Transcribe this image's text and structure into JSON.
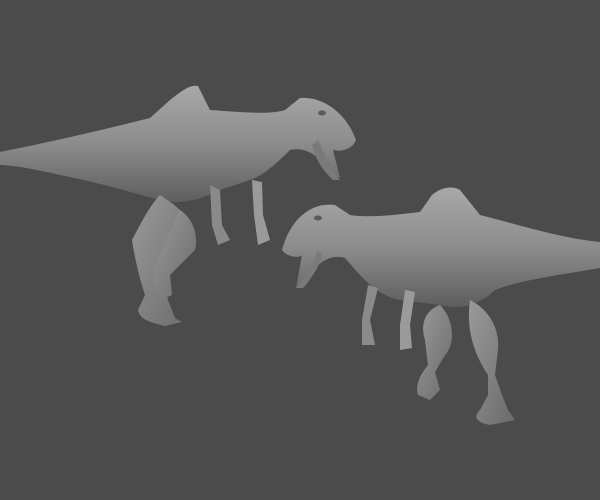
{
  "scene": {
    "background": "#4b4b4b",
    "model_color": "#8e8e8e",
    "models": [
      {
        "name": "dinosaur-left",
        "facing": "right"
      },
      {
        "name": "dinosaur-right",
        "facing": "left"
      }
    ]
  }
}
